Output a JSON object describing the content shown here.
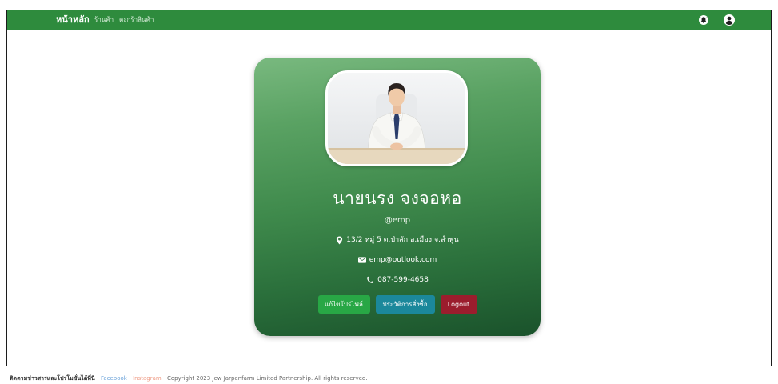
{
  "navbar": {
    "home": "หน้าหลัก",
    "shop": "ร้านค้า",
    "cart": "ตะกร้าสินค้า",
    "notification_icon": "bell-icon",
    "account_icon": "user-circle-icon"
  },
  "profile": {
    "name": "นายนรง จงจอหอ",
    "username": "@emp",
    "address": "13/2 หมู่ 5 ต.ป่าสัก อ.เมือง จ.ลำพูน",
    "email": "emp@outlook.com",
    "phone": "087-599-4658",
    "address_icon": "map-marker-icon",
    "email_icon": "envelope-icon",
    "phone_icon": "phone-icon"
  },
  "actions": {
    "edit_profile": "แก้ไขโปรไฟล์",
    "order_history": "ประวัติการสั่งซื้อ",
    "logout": "Logout"
  },
  "footer": {
    "follow_text": "ติดตามข่าวสารและโปรโมชั่นได้ที่นี่",
    "facebook": "Facebook",
    "instagram": "Instagram",
    "copyright": "Copyright 2023 Jew Jarpenfarm Limited Partnership. All rights reserved."
  },
  "colors": {
    "navbar": "#2e8b3d",
    "card_top": "#79b97f",
    "card_bottom": "#1a522b",
    "edit_button": "#28a745",
    "history_button": "#1b889b",
    "logout_button": "#9b1d2d",
    "facebook_link": "#6aa2d9",
    "instagram_link": "#ef9c86"
  }
}
